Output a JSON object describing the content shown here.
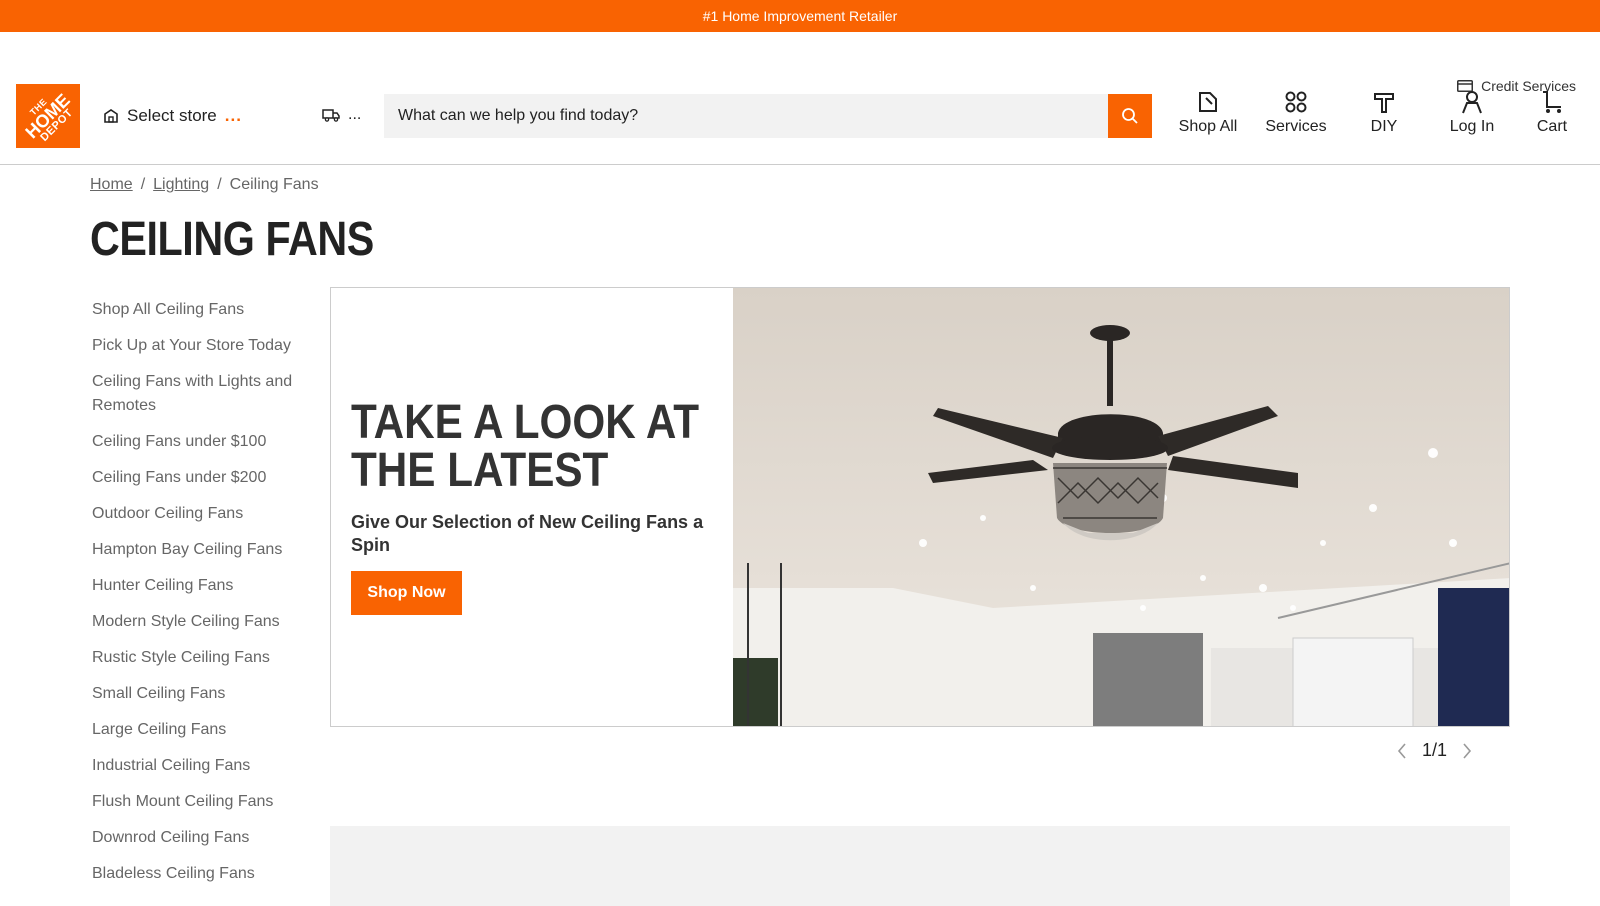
{
  "promo": {
    "text": "#1 Home Improvement Retailer"
  },
  "utility": {
    "credit_services": "Credit Services"
  },
  "logo": {
    "line1": "THE",
    "line2": "HOME",
    "line3": "DEPOT"
  },
  "store": {
    "label": "Select store",
    "dots": "..."
  },
  "delivery": {
    "dots": "..."
  },
  "search": {
    "placeholder": "What can we help you find today?"
  },
  "nav": {
    "shop_all": "Shop All",
    "services": "Services",
    "diy": "DIY",
    "log_in": "Log In",
    "cart": "Cart"
  },
  "breadcrumb": {
    "home": "Home",
    "lighting": "Lighting",
    "current": "Ceiling Fans",
    "sep": "/"
  },
  "page": {
    "title": "CEILING FANS"
  },
  "side_nav": [
    "Shop All Ceiling Fans",
    "Pick Up at Your Store Today",
    "Ceiling Fans with Lights and Remotes",
    "Ceiling Fans under $100",
    "Ceiling Fans under $200",
    "Outdoor Ceiling Fans",
    "Hampton Bay Ceiling Fans",
    "Hunter Ceiling Fans",
    "Modern Style Ceiling Fans",
    "Rustic Style Ceiling Fans",
    "Small Ceiling Fans",
    "Large Ceiling Fans",
    "Industrial Ceiling Fans",
    "Flush Mount Ceiling Fans",
    "Downrod Ceiling Fans",
    "Bladeless Ceiling Fans"
  ],
  "hero": {
    "title_line1": "TAKE A LOOK AT",
    "title_line2": "THE LATEST",
    "subtitle": "Give Our Selection of New Ceiling Fans a Spin",
    "cta": "Shop Now"
  },
  "pager": {
    "text": "1/1"
  },
  "colors": {
    "brand_orange": "#f96302"
  }
}
